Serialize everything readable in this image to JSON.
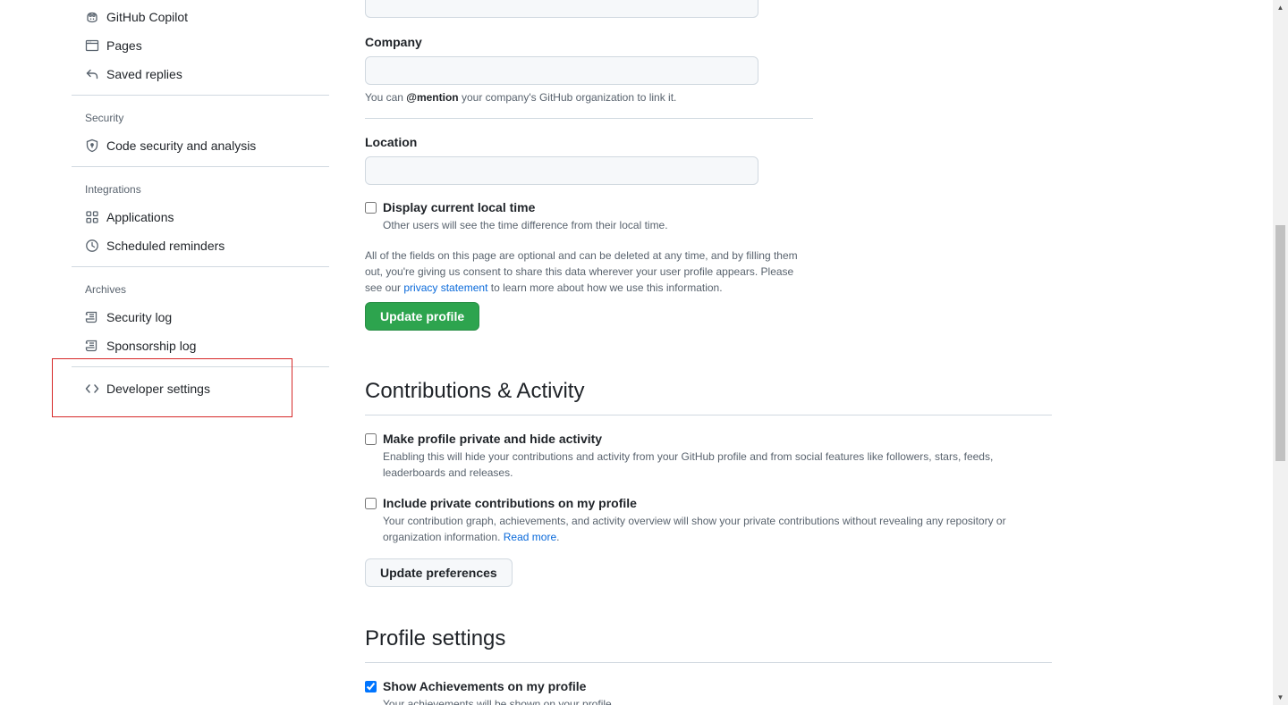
{
  "sidebar": {
    "items": [
      {
        "label": "GitHub Copilot",
        "icon": "copilot-icon"
      },
      {
        "label": "Pages",
        "icon": "browser-icon"
      },
      {
        "label": "Saved replies",
        "icon": "reply-icon"
      }
    ],
    "security": {
      "title": "Security",
      "items": [
        {
          "label": "Code security and analysis",
          "icon": "shield-icon"
        }
      ]
    },
    "integrations": {
      "title": "Integrations",
      "items": [
        {
          "label": "Applications",
          "icon": "apps-icon"
        },
        {
          "label": "Scheduled reminders",
          "icon": "clock-icon"
        }
      ]
    },
    "archives": {
      "title": "Archives",
      "items": [
        {
          "label": "Security log",
          "icon": "log-icon"
        },
        {
          "label": "Sponsorship log",
          "icon": "log-icon"
        }
      ]
    },
    "developer": {
      "label": "Developer settings",
      "icon": "code-icon"
    }
  },
  "profile_form": {
    "company": {
      "label": "Company",
      "value": "",
      "hint_prefix": "You can ",
      "hint_mention": "@mention",
      "hint_suffix": " your company's GitHub organization to link it."
    },
    "location": {
      "label": "Location",
      "value": ""
    },
    "local_time": {
      "label": "Display current local time",
      "description": "Other users will see the time difference from their local time.",
      "checked": false
    },
    "consent": {
      "text_before": "All of the fields on this page are optional and can be deleted at any time, and by filling them out, you're giving us consent to share this data wherever your user profile appears. Please see our ",
      "link": "privacy statement",
      "text_after": " to learn more about how we use this information."
    },
    "update_button": "Update profile"
  },
  "contributions": {
    "heading": "Contributions & Activity",
    "private_profile": {
      "label": "Make profile private and hide activity",
      "description": "Enabling this will hide your contributions and activity from your GitHub profile and from social features like followers, stars, feeds, leaderboards and releases.",
      "checked": false
    },
    "private_contributions": {
      "label": "Include private contributions on my profile",
      "description": "Your contribution graph, achievements, and activity overview will show your private contributions without revealing any repository or organization information. ",
      "link": "Read more",
      "link_suffix": ".",
      "checked": false
    },
    "update_button": "Update preferences"
  },
  "profile_settings": {
    "heading": "Profile settings",
    "achievements": {
      "label": "Show Achievements on my profile",
      "description": "Your achievements will be shown on your profile.",
      "checked": true
    }
  },
  "colors": {
    "primary_button": "#2da44e",
    "link": "#0969da",
    "highlight_box": "#d62828"
  }
}
